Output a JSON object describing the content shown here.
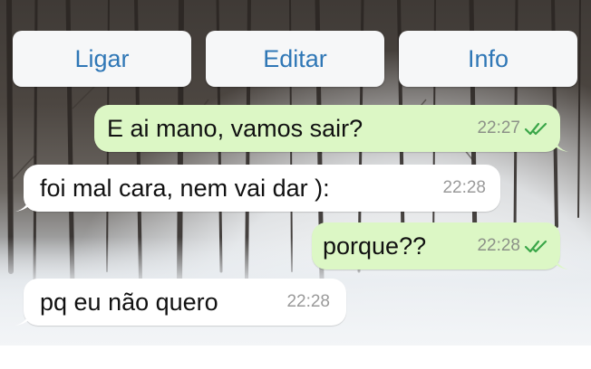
{
  "actions": {
    "call_label": "Ligar",
    "edit_label": "Editar",
    "info_label": "Info"
  },
  "messages": [
    {
      "direction": "outgoing",
      "text": "E ai mano, vamos sair?",
      "time": "22:27",
      "status": "read"
    },
    {
      "direction": "incoming",
      "text": "foi mal cara, nem vai dar ):",
      "time": "22:28"
    },
    {
      "direction": "outgoing",
      "text": "porque??",
      "time": "22:28",
      "status": "read"
    },
    {
      "direction": "incoming",
      "text": "pq eu não quero",
      "time": "22:28"
    }
  ],
  "colors": {
    "outgoing_bubble": "#dcf7c5",
    "incoming_bubble": "#ffffff",
    "action_text": "#2f77b6",
    "read_ticks": "#3aa648"
  },
  "icons": {
    "read_receipt": "double-check-icon"
  }
}
